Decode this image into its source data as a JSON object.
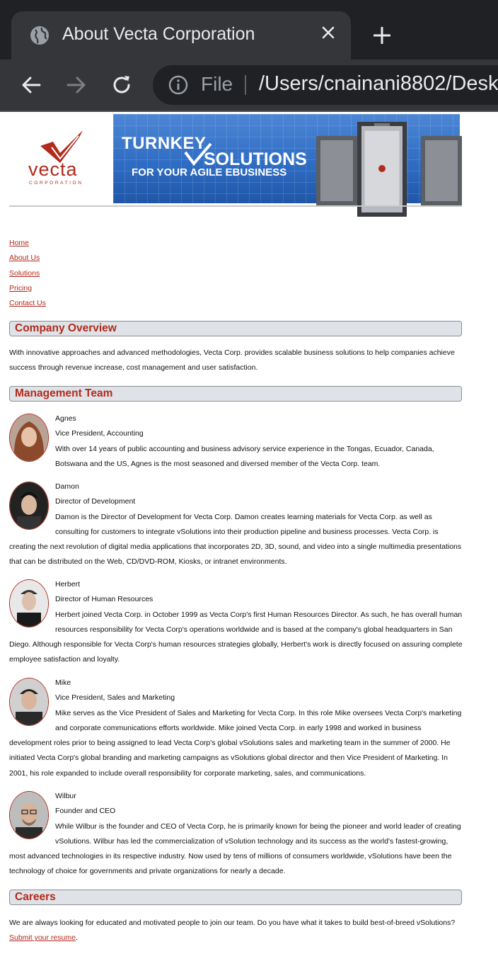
{
  "browser": {
    "tab_title": "About Vecta Corporation",
    "address_scheme_label": "File",
    "address_url": "/Users/cnainani8802/Desk"
  },
  "header": {
    "logo_text": "vecta",
    "logo_subtext": "CORPORATION",
    "banner_line1": "TURNKEY",
    "banner_line2": "SOLUTIONS",
    "banner_line3": "FOR YOUR AGILE EBUSINESS"
  },
  "nav": {
    "items": [
      "Home",
      "About Us",
      "Solutions",
      "Pricing",
      "Contact Us"
    ]
  },
  "sections": {
    "overview_title": "Company Overview",
    "overview_text": "With innovative approaches and advanced methodologies, Vecta Corp. provides scalable business solutions to help companies achieve success through revenue increase, cost management and user satisfaction.",
    "team_title": "Management Team",
    "careers_title": "Careers",
    "careers_text": "We are always looking for educated and motivated people to join our team. Do you have what it takes to build best-of-breed vSolutions?",
    "careers_link": "Submit your resume",
    "careers_link_suffix": "."
  },
  "team": [
    {
      "name": "Agnes",
      "title": "Vice President, Accounting",
      "bio": "With over 14 years of public accounting and business advisory service experience in the Tongas, Ecuador, Canada, Botswana and the US, Agnes is the most seasoned and diversed member of the Vecta Corp. team."
    },
    {
      "name": "Damon",
      "title": "Director of Development",
      "bio": "Damon is the Director of Development for Vecta Corp. Damon creates learning materials for Vecta Corp. as well as consulting for customers to integrate vSolutions into their production pipeline and business processes. Vecta Corp. is creating the next revolution of digital media applications that incorporates 2D, 3D, sound, and video into a single multimedia presentations that can be distributed on the Web, CD/DVD-ROM, Kiosks, or intranet environments."
    },
    {
      "name": "Herbert",
      "title": "Director of Human Resources",
      "bio": "Herbert joined Vecta Corp. in October 1999 as Vecta Corp's first Human Resources Director. As such, he has overall human resources responsibility for Vecta Corp's operations worldwide and is based at the company's global headquarters in San Diego. Although responsible for Vecta Corp's human resources strategies globally, Herbert's work is directly focused on assuring complete employee satisfaction and loyalty."
    },
    {
      "name": "Mike",
      "title": "Vice President, Sales and Marketing",
      "bio": "Mike serves as the Vice President of Sales and Marketing for Vecta Corp. In this role Mike oversees Vecta Corp's marketing and corporate communications efforts worldwide. Mike joined Vecta Corp. in early 1998 and worked in business development roles prior to being assigned to lead Vecta Corp's global vSolutions sales and marketing team in the summer of 2000. He initiated Vecta Corp's global branding and marketing campaigns as vSolutions global director and then Vice President of Marketing. In 2001, his role expanded to include overall responsibility for corporate marketing, sales, and communications."
    },
    {
      "name": "Wilbur",
      "title": "Founder and CEO",
      "bio": "While Wilbur is the founder and CEO of Vecta Corp, he is primarily known for being the pioneer and world leader of creating vSolutions. Wilbur has led the commercialization of vSolution technology and its success as the world's fastest-growing, most advanced technologies in its respective industry. Now used by tens of millions of consumers worldwide, vSolutions have been the technology of choice for governments and private organizations for nearly a decade."
    }
  ],
  "colors": {
    "accent_red": "#b22a1c",
    "section_bar_bg": "#dfe2e6",
    "banner_blue": "#2f6dc4"
  }
}
